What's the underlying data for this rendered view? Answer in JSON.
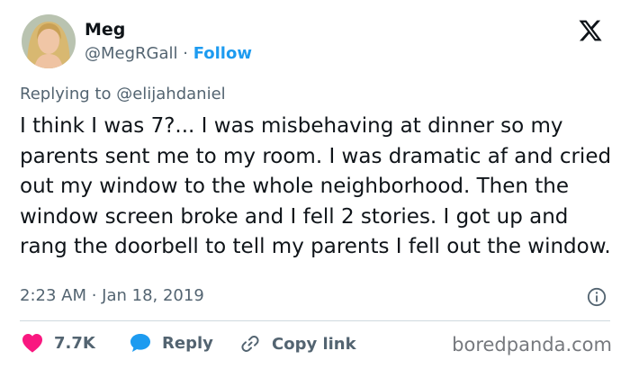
{
  "user": {
    "display_name": "Meg",
    "handle": "@MegRGall",
    "separator": " · ",
    "follow_label": "Follow"
  },
  "tweet": {
    "replying_to": "Replying to @elijahdaniel",
    "text": "I think I was 7?... I was misbehaving at dinner so my parents sent me to my room. I was dramatic af and cried out my window to the whole neighborhood. Then the window screen broke and I fell 2 stories. I got up and rang the doorbell to tell my parents I fell out the window.",
    "timestamp": "2:23 AM · Jan 18, 2019"
  },
  "actions": {
    "likes_count": "7.7K",
    "reply_label": "Reply",
    "copy_link_label": "Copy link"
  },
  "watermark": "boredpanda.com",
  "icons": {
    "avatar": "avatar-photo",
    "logo": "x-logo-icon",
    "info": "info-icon",
    "like": "heart-icon",
    "reply": "speech-bubble-icon",
    "copy": "link-icon"
  },
  "colors": {
    "accent": "#1d9bf0",
    "like": "#f91880",
    "text": "#0f1419",
    "muted": "#536471"
  }
}
